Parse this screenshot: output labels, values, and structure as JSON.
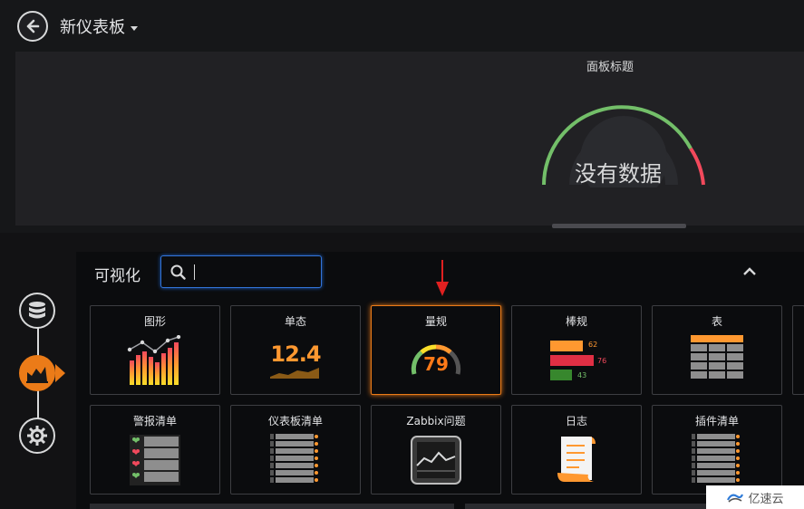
{
  "header": {
    "title": "新仪表板"
  },
  "preview": {
    "panel_title": "面板标题",
    "no_data": "没有数据"
  },
  "viz": {
    "label": "可视化",
    "search_value": ""
  },
  "cards_row1": [
    {
      "label": "图形",
      "icon": "graph-icon"
    },
    {
      "label": "单态",
      "icon": "singlestat-icon",
      "value": "12.4"
    },
    {
      "label": "量规",
      "icon": "gauge-icon",
      "value": "79"
    },
    {
      "label": "棒规",
      "icon": "bar-gauge-icon",
      "values": [
        "62",
        "76",
        "43"
      ]
    },
    {
      "label": "表",
      "icon": "table-icon"
    }
  ],
  "cards_row2": [
    {
      "label": "警报清单",
      "icon": "alert-list-icon"
    },
    {
      "label": "仪表板清单",
      "icon": "dashboard-list-icon"
    },
    {
      "label": "Zabbix问题",
      "icon": "zabbix-problems-icon"
    },
    {
      "label": "日志",
      "icon": "logs-icon"
    },
    {
      "label": "插件清单",
      "icon": "plugin-list-icon"
    }
  ],
  "watermark": "亿速云",
  "colors": {
    "accent": "#eb7b18",
    "focus": "#3274d9",
    "green": "#73bf69",
    "red": "#f2495c"
  }
}
